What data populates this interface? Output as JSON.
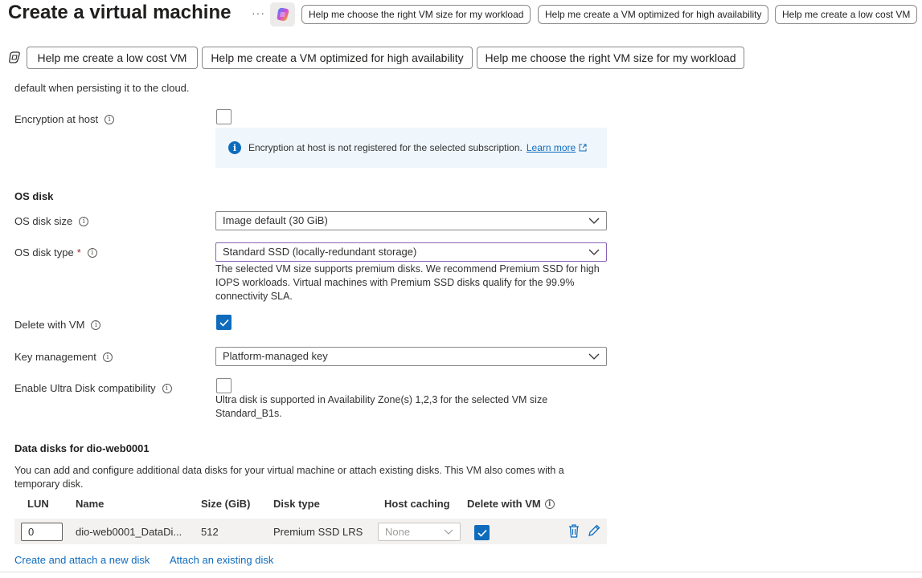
{
  "header": {
    "title": "Create a virtual machine",
    "more": "···",
    "chips": [
      "Help me choose the right VM size for my workload",
      "Help me create a VM optimized for high availability",
      "Help me create a low cost VM"
    ]
  },
  "copilot_prompts": [
    "Help me create a low cost VM",
    "Help me create a VM optimized for high availability",
    "Help me choose the right VM size for my workload"
  ],
  "encryption": {
    "cut_line": "default when persisting it to the cloud.",
    "host_label": "Encryption at host",
    "info_text": "Encryption at host is not registered for the selected subscription.",
    "learn_more": "Learn more"
  },
  "os_disk": {
    "heading": "OS disk",
    "size_label": "OS disk size",
    "size_value": "Image default (30 GiB)",
    "type_label": "OS disk type",
    "required_mark": "*",
    "type_value": "Standard SSD (locally-redundant storage)",
    "type_help": "The selected VM size supports premium disks. We recommend Premium SSD for high IOPS workloads. Virtual machines with Premium SSD disks qualify for the 99.9% connectivity SLA.",
    "delete_label": "Delete with VM",
    "delete_checked": true,
    "key_label": "Key management",
    "key_value": "Platform-managed key",
    "ultra_label": "Enable Ultra Disk compatibility",
    "ultra_checked": false,
    "ultra_help": "Ultra disk is supported in Availability Zone(s) 1,2,3 for the selected VM size Standard_B1s."
  },
  "data_disks": {
    "heading": "Data disks for dio-web0001",
    "description": "You can add and configure additional data disks for your virtual machine or attach existing disks. This VM also comes with a temporary disk.",
    "columns": [
      "LUN",
      "Name",
      "Size (GiB)",
      "Disk type",
      "Host caching",
      "Delete with VM"
    ],
    "rows": [
      {
        "lun": "0",
        "name": "dio-web0001_DataDi...",
        "size": "512",
        "disk_type": "Premium SSD LRS",
        "host_caching": "None",
        "delete_with_vm": true
      }
    ],
    "create_link": "Create and attach a new disk",
    "attach_link": "Attach an existing disk"
  },
  "colors": {
    "accent": "#0f6cbd",
    "info_bg": "#eff6fc",
    "focus_border": "#8764b8",
    "required": "#a4262c"
  },
  "icons": {
    "copilot": "copilot-icon",
    "info": "info-icon",
    "chevron": "chevron-down-icon",
    "delete": "trash-icon",
    "edit": "pencil-icon",
    "external": "external-link-icon"
  }
}
